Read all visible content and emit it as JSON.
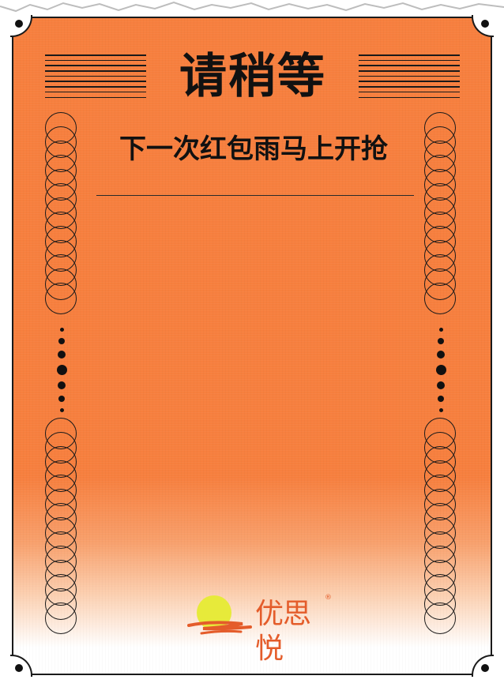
{
  "title": "请稍等",
  "subtitle": "下一次红包雨马上开抢",
  "logo": {
    "text": "优思悦",
    "registered_mark": "®"
  },
  "colors": {
    "background_orange": "#f77f3e",
    "ink": "#111111",
    "logo_orange": "#e45c2a",
    "logo_sun": "#e7ea3a"
  }
}
